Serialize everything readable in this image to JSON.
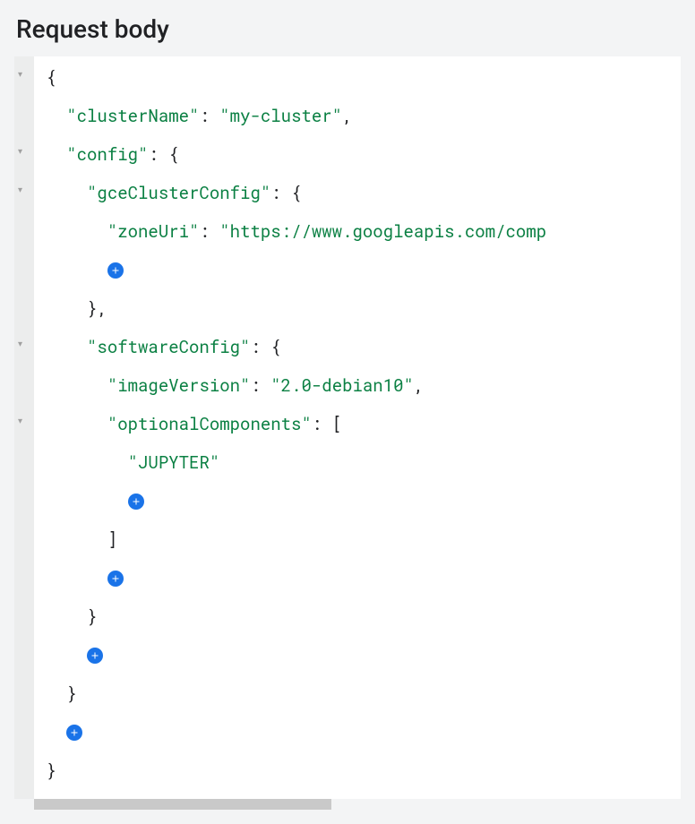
{
  "section_title": "Request body",
  "json": {
    "clusterName_key": "\"clusterName\"",
    "clusterName_value": "\"my-cluster\"",
    "config_key": "\"config\"",
    "gceClusterConfig_key": "\"gceClusterConfig\"",
    "zoneUri_key": "\"zoneUri\"",
    "zoneUri_value": "\"https://www.googleapis.com/comp",
    "softwareConfig_key": "\"softwareConfig\"",
    "imageVersion_key": "\"imageVersion\"",
    "imageVersion_value": "\"2.0-debian10\"",
    "optionalComponents_key": "\"optionalComponents\"",
    "optionalComponents_item0": "\"JUPYTER\""
  },
  "punct": {
    "colon_space": ": ",
    "comma": ",",
    "open_brace": "{",
    "close_brace": "}",
    "open_bracket": "[",
    "close_bracket": "]",
    "close_brace_comma": "},"
  }
}
